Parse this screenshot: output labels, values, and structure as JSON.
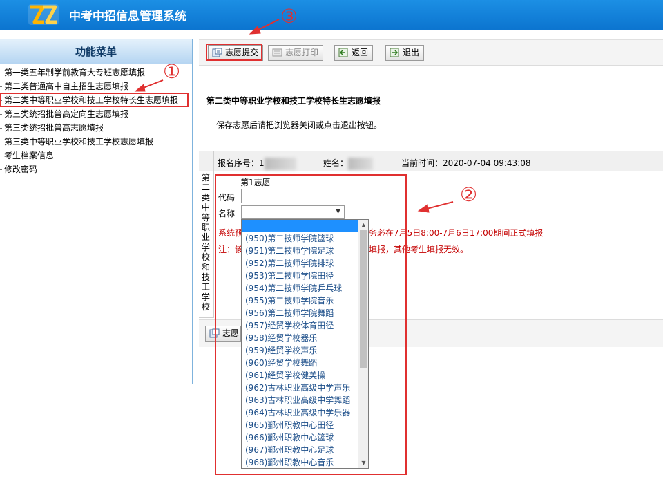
{
  "header": {
    "app_title": "中考中招信息管理系统",
    "logo_icon": "zz-logo-icon"
  },
  "sidebar": {
    "title": "功能菜单",
    "items": [
      {
        "label": "第一类五年制学前教育大专班志愿填报"
      },
      {
        "label": "第二类普通高中自主招生志愿填报"
      },
      {
        "label": "第二类中等职业学校和技工学校特长生志愿填报"
      },
      {
        "label": "第三类统招批普高定向生志愿填报"
      },
      {
        "label": "第三类统招批普高志愿填报"
      },
      {
        "label": "第三类中等职业学校和技工学校志愿填报"
      },
      {
        "label": "考生档案信息"
      },
      {
        "label": "修改密码"
      }
    ]
  },
  "toolbar": {
    "submit_label": "志愿提交",
    "print_label": "志愿打印",
    "back_label": "返回",
    "exit_label": "退出"
  },
  "form": {
    "title": "第二类中等职业学校和技工学校特长生志愿填报",
    "hint": "保存志愿后请把浏览器关闭或点击退出按钮。",
    "reg_label": "报名序号：",
    "reg_value": "1",
    "name_label": "姓名：",
    "time_label": "当前时间：",
    "time_value": "2020-07-04 09:43:08",
    "vertical_title": "第二类中等职业学校和技工学校",
    "choice_label": "第1志愿",
    "code_label": "代码",
    "name_field_label": "名称",
    "notice_line1_left": "系统预",
    "notice_line1_right": "务必在7月5日8:00-7月6日17:00期间正式填报",
    "notice_line2_left": "注：该",
    "notice_line2_right": "填报，其他考生填报无效。",
    "bottom_submit_label": "志愿"
  },
  "dropdown": {
    "options": [
      "",
      "(950)第二技师学院篮球",
      "(951)第二技师学院足球",
      "(952)第二技师学院排球",
      "(953)第二技师学院田径",
      "(954)第二技师学院乒乓球",
      "(955)第二技师学院音乐",
      "(956)第二技师学院舞蹈",
      "(957)经贸学校体育田径",
      "(958)经贸学校器乐",
      "(959)经贸学校声乐",
      "(960)经贸学校舞蹈",
      "(961)经贸学校健美操",
      "(962)古林职业高级中学声乐",
      "(963)古林职业高级中学舞蹈",
      "(964)古林职业高级中学乐器",
      "(965)鄞州职教中心田径",
      "(966)鄞州职教中心篮球",
      "(967)鄞州职教中心足球",
      "(968)鄞州职教中心音乐"
    ]
  },
  "annotations": {
    "n1": "①",
    "n2": "②",
    "n3": "③"
  },
  "colors": {
    "header": "#0b74cf",
    "annotation": "#e03030",
    "notice": "#c40000",
    "highlight": "#1e90ff"
  }
}
